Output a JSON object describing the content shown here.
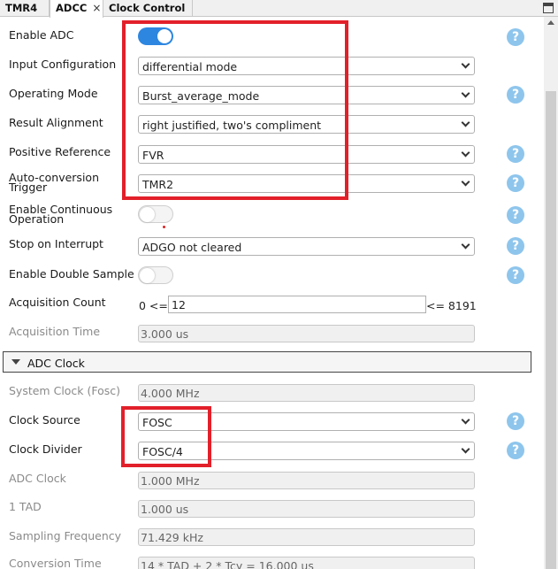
{
  "tabs": [
    {
      "label": "TMR4",
      "active": false
    },
    {
      "label": "ADCC",
      "active": true,
      "close": "×"
    },
    {
      "label": "Clock Control",
      "active": false
    }
  ],
  "help_glyph": "?",
  "fields": {
    "enable_adc": {
      "label": "Enable ADC",
      "state": "on"
    },
    "input_config": {
      "label": "Input Configuration",
      "value": "differential mode"
    },
    "operating_mode": {
      "label": "Operating Mode",
      "value": "Burst_average_mode"
    },
    "result_alignment": {
      "label": "Result Alignment",
      "value": "right justified, two's compliment"
    },
    "positive_ref": {
      "label": "Positive Reference",
      "value": "FVR"
    },
    "auto_conv_trigger": {
      "label": "Auto-conversion Trigger",
      "value": "TMR2"
    },
    "continuous_op": {
      "label": "Enable Continuous Operation",
      "state": "off"
    },
    "stop_on_interrupt": {
      "label": "Stop on Interrupt",
      "value": "ADGO not cleared"
    },
    "double_sample": {
      "label": "Enable Double Sample",
      "state": "off"
    },
    "acq_count": {
      "label": "Acquisition Count",
      "prefix": "0 <=",
      "value": "12",
      "suffix": "<= 8191"
    },
    "acq_time": {
      "label": "Acquisition Time",
      "value": "3.000 us"
    }
  },
  "adc_clock_section": {
    "title": "ADC Clock",
    "system_clock": {
      "label": "System Clock (Fosc)",
      "value": "4.000 MHz"
    },
    "clock_source": {
      "label": "Clock Source",
      "value": "FOSC"
    },
    "clock_divider": {
      "label": "Clock Divider",
      "value": "FOSC/4"
    },
    "adc_clock": {
      "label": "ADC Clock",
      "value": "1.000 MHz"
    },
    "tad": {
      "label": "1 TAD",
      "value": "1.000 us"
    },
    "sampling_freq": {
      "label": "Sampling Frequency",
      "value": "71.429 kHz"
    },
    "conversion_time": {
      "label": "Conversion Time",
      "value": "14 * TAD + 2 * Tcy = 16.000 us"
    }
  },
  "colors": {
    "highlight": "#e2202a",
    "toggle_on": "#2d86e0",
    "help_icon": "#8ec5ec"
  }
}
